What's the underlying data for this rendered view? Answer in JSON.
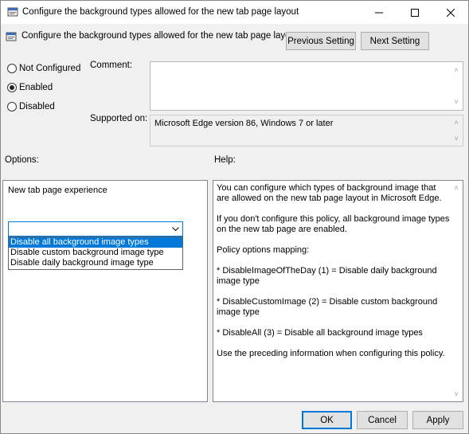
{
  "window": {
    "title": "Configure the background types allowed for the new tab page layout"
  },
  "header": {
    "policy_title": "Configure the background types allowed for the new tab page layout",
    "prev_label": "Previous Setting",
    "next_label": "Next Setting"
  },
  "state": {
    "options": [
      "Not Configured",
      "Enabled",
      "Disabled"
    ],
    "selected": "Enabled"
  },
  "comment": {
    "label": "Comment:",
    "value": ""
  },
  "supported": {
    "label": "Supported on:",
    "value": "Microsoft Edge version 86, Windows 7 or later"
  },
  "options_pane": {
    "header": "Options:",
    "field_label": "New tab page experience",
    "combo_value": "",
    "dropdown_items": [
      "Disable all background image types",
      "Disable custom background image type",
      "Disable daily background image type"
    ],
    "highlighted_index": 0
  },
  "help_pane": {
    "header": "Help:",
    "paragraphs": [
      "You can configure which types of background image that are allowed on the new tab page layout in Microsoft Edge.",
      "If you don't configure this policy, all background image types on the new tab page are enabled.",
      "Policy options mapping:",
      "* DisableImageOfTheDay (1) = Disable daily background image type",
      "* DisableCustomImage (2) = Disable custom background image type",
      "* DisableAll (3) = Disable all background image types",
      "Use the preceding information when configuring this policy."
    ]
  },
  "footer": {
    "ok_label": "OK",
    "cancel_label": "Cancel",
    "apply_label": "Apply"
  },
  "colors": {
    "accent": "#0078d7",
    "dialog_bg": "#f0f0f0"
  },
  "icons": [
    "policy-icon",
    "minimize-icon",
    "maximize-icon",
    "close-icon"
  ]
}
